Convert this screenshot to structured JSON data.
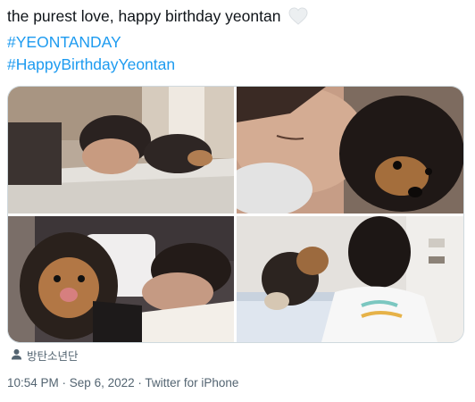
{
  "tweet": {
    "text": "the purest love, happy birthday yeontan",
    "emoji_icon": "white-heart-icon",
    "hashtags": [
      "#YEONTANDAY",
      "#HappyBirthdayYeontan"
    ]
  },
  "media": {
    "photos": [
      {
        "icon": "photo-man-sleeping-with-dog-on-bed"
      },
      {
        "icon": "photo-closeup-man-face-and-dog"
      },
      {
        "icon": "photo-dog-and-man-lying-on-pillow"
      },
      {
        "icon": "photo-dog-kissing-man"
      }
    ]
  },
  "tagged": {
    "icon": "person-icon",
    "name": "방탄소년단"
  },
  "meta": {
    "time": "10:54 PM",
    "sep1": " · ",
    "date": "Sep 6, 2022",
    "sep2": " · ",
    "source": "Twitter for iPhone"
  },
  "colors": {
    "text": "#0f1419",
    "link": "#1d9bf0",
    "secondary": "#536471",
    "border": "#cfd9de"
  }
}
